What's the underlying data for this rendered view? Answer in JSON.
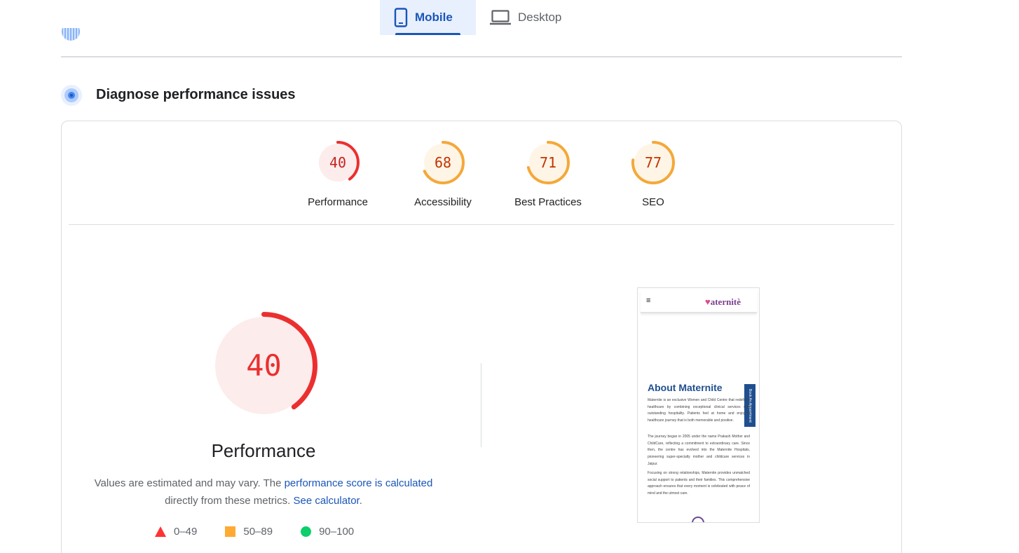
{
  "device_tabs": {
    "mobile": "Mobile",
    "desktop": "Desktop",
    "selected": "mobile"
  },
  "section": {
    "title": "Diagnose performance issues"
  },
  "gauges": [
    {
      "value": "40",
      "label": "Performance",
      "score": 40,
      "color": "#eb2f2f",
      "bg": "#fdecec"
    },
    {
      "value": "68",
      "label": "Accessibility",
      "score": 68,
      "color": "#f4a83a",
      "bg": "#fff5e6"
    },
    {
      "value": "71",
      "label": "Best Practices",
      "score": 71,
      "color": "#f4a83a",
      "bg": "#fff5e6"
    },
    {
      "value": "77",
      "label": "SEO",
      "score": 77,
      "color": "#f4a83a",
      "bg": "#fff5e6"
    }
  ],
  "performance": {
    "score": "40",
    "title": "Performance",
    "explain_prefix": "Values are estimated and may vary. The ",
    "explain_link": "performance score is calculated",
    "explain_mid": " directly from these metrics. ",
    "calculator_link": "See calculator",
    "explain_suffix": "."
  },
  "legend": [
    {
      "icon": "triangle-icon",
      "range": "0–49",
      "color": "#ff3333"
    },
    {
      "icon": "square-icon",
      "range": "50–89",
      "color": "#ffaa33"
    },
    {
      "icon": "circle-icon",
      "range": "90–100",
      "color": "#0cce6b"
    }
  ],
  "screenshot": {
    "hamburger": "≡",
    "logo_heart": "♥",
    "logo_text": "aternitè",
    "heading": "About Maternite",
    "book_tab": "Book An Appointment",
    "paragraphs": [
      "Maternite is an exclusive Women and Child Centre that redefines healthcare by combining exceptional clinical services with outstanding hospitality. Patients feel at home and enjoy a healthcare journey that is both memorable and positive.",
      "The journey began in 2005 under the name Prakash Mother and ChildCare, reflecting a commitment to extraordinary care. Since then, the centre has evolved into the Maternite Hospitals, pioneering super-specialty mother and childcare services in Jaipur.",
      "Focusing on strong relationships, Maternite provides unmatched social support to patients and their families. This comprehensive approach ensures that every moment is celebrated with peace of mind and the utmost care."
    ]
  }
}
